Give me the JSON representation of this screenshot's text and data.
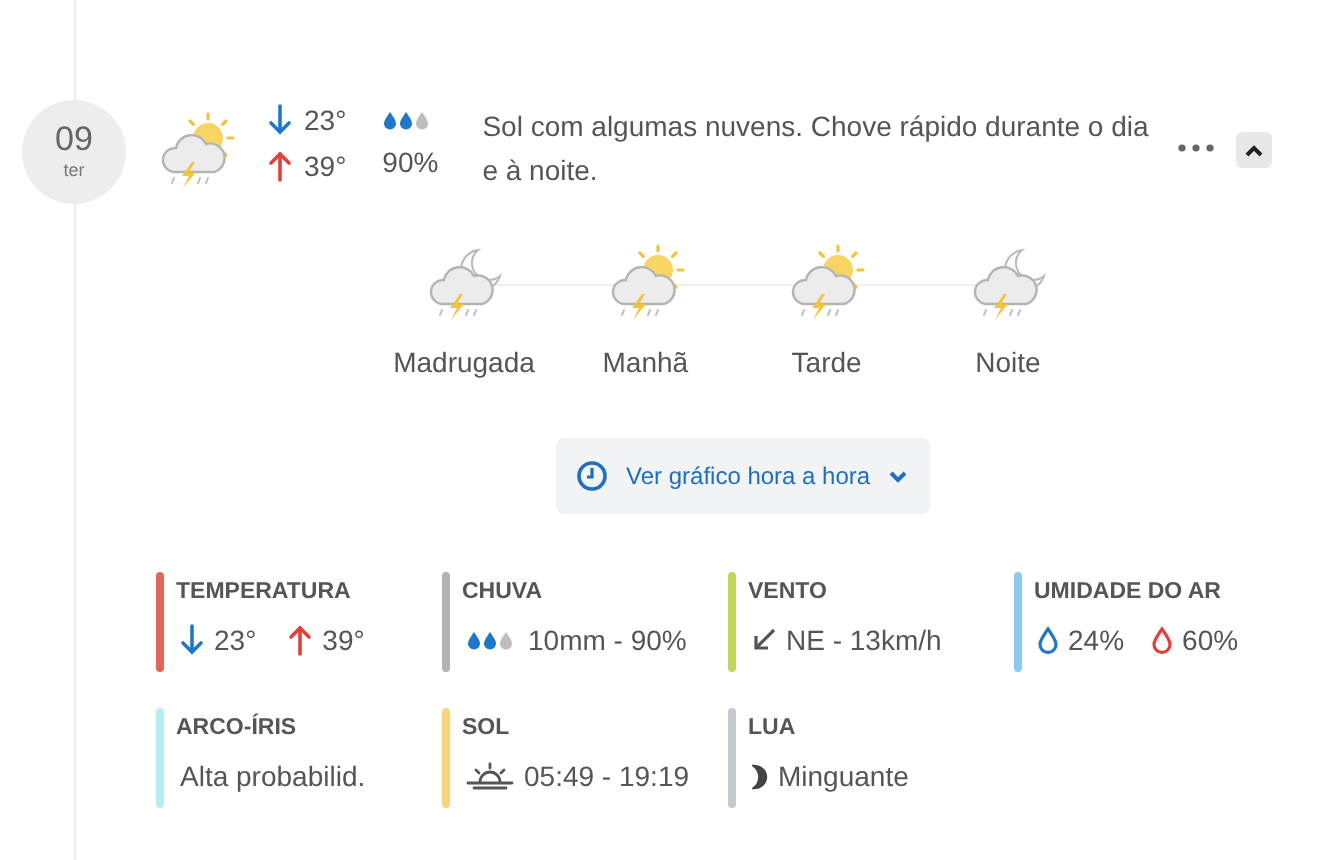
{
  "day": {
    "date": "09",
    "weekday": "ter",
    "min": "23°",
    "max": "39°",
    "rain_chance": "90%",
    "summary": "Sol com algumas nuvens. Chove rápido durante o dia e à noite."
  },
  "periods": [
    {
      "label": "Madrugada",
      "kind": "moon"
    },
    {
      "label": "Manhã",
      "kind": "sun"
    },
    {
      "label": "Tarde",
      "kind": "sun"
    },
    {
      "label": "Noite",
      "kind": "moon"
    }
  ],
  "hourly_button": {
    "label": "Ver gráfico hora a hora"
  },
  "details": [
    {
      "kind": "temperature",
      "title": "TEMPERATURA",
      "color": "#e0675a",
      "min": "23°",
      "max": "39°"
    },
    {
      "kind": "rain",
      "title": "CHUVA",
      "color": "#b3b3b3",
      "value": "10mm - 90%"
    },
    {
      "kind": "wind",
      "title": "VENTO",
      "color": "#c3d45a",
      "value": "NE - 13km/h"
    },
    {
      "kind": "humidity",
      "title": "UMIDADE DO AR",
      "color": "#8cc8f0",
      "min": "24%",
      "max": "60%"
    },
    {
      "kind": "text",
      "title": "ARCO-ÍRIS",
      "color": "#b8ecf2",
      "value": "Alta probabilid."
    },
    {
      "kind": "sun",
      "title": "SOL",
      "color": "#f7d57a",
      "value": "05:49 - 19:19"
    },
    {
      "kind": "moon",
      "title": "LUA",
      "color": "#c3c9cf",
      "value": "Minguante"
    }
  ]
}
